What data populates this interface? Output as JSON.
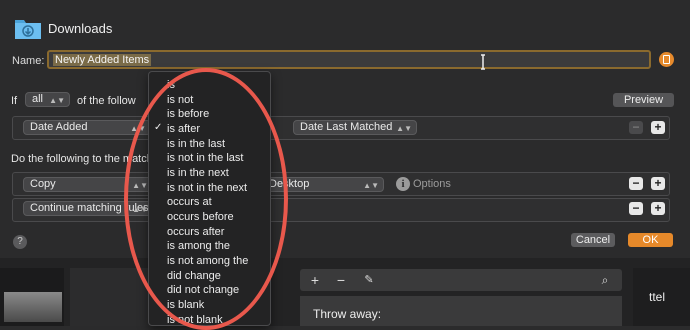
{
  "window": {
    "title": "Downloads"
  },
  "name_row": {
    "label": "Name:",
    "value": "Newly Added Items"
  },
  "conditions": {
    "if_label": "If",
    "match_select": "all",
    "of_label": "of the follow",
    "preview_label": "Preview",
    "attribute_select": "Date Added",
    "value_select": "Date Last Matched"
  },
  "operator_menu": {
    "selected": "is after",
    "items": [
      "is",
      "is not",
      "is before",
      "is after",
      "is in the last",
      "is not in the last",
      "is in the next",
      "is not in the next",
      "occurs at",
      "occurs before",
      "occurs after",
      "is among the",
      "is not among the",
      "did change",
      "did not change",
      "is blank",
      "is not blank"
    ]
  },
  "actions": {
    "label": "Do the following to the match",
    "action1": "Copy",
    "destination": "Desktop",
    "options_label": "Options",
    "action2": "Continue matching rules"
  },
  "footer": {
    "help": "?",
    "cancel": "Cancel",
    "ok": "OK"
  },
  "background": {
    "throw_away": "Throw away:",
    "right_text": "ttel"
  }
}
